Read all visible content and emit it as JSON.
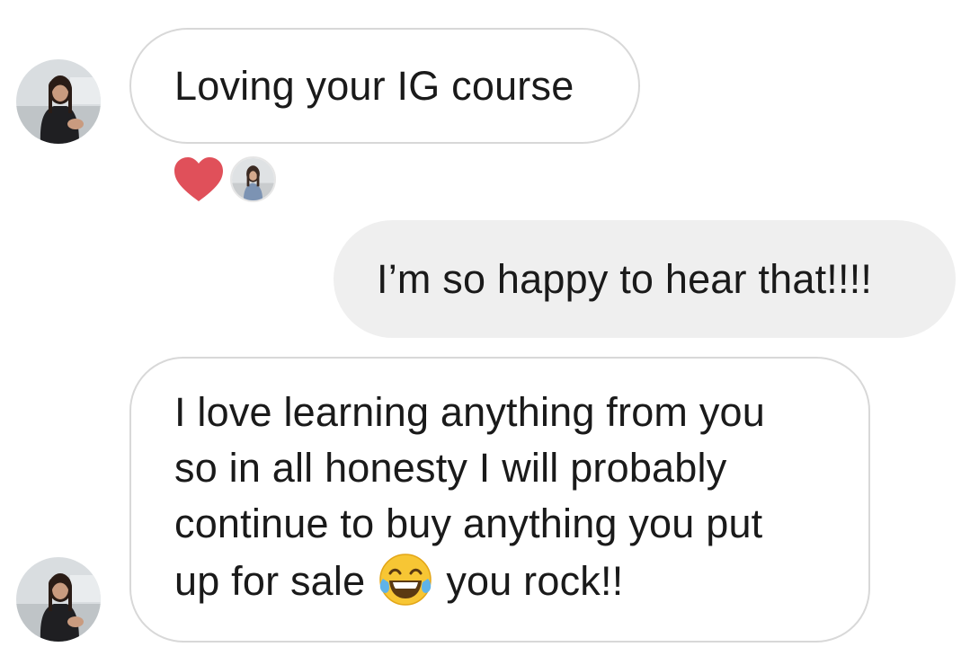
{
  "messages": [
    {
      "direction": "incoming",
      "text": "Loving your IG course",
      "reaction": {
        "icon": "heart-icon",
        "color": "#e0505a"
      }
    },
    {
      "direction": "outgoing",
      "text": "I’m so happy to hear that!!!!"
    },
    {
      "direction": "incoming",
      "lines": [
        "I love learning anything from you",
        "so in all honesty I will probably",
        "continue to buy anything you put",
        "up for sale"
      ],
      "emoji": "face-with-tears-of-joy-icon",
      "after_emoji": "you rock!!"
    }
  ],
  "colors": {
    "incoming_bubble_border": "#d8d8d8",
    "outgoing_bubble_bg": "#efefef",
    "text": "#1a1a1a",
    "heart": "#e0505a"
  }
}
